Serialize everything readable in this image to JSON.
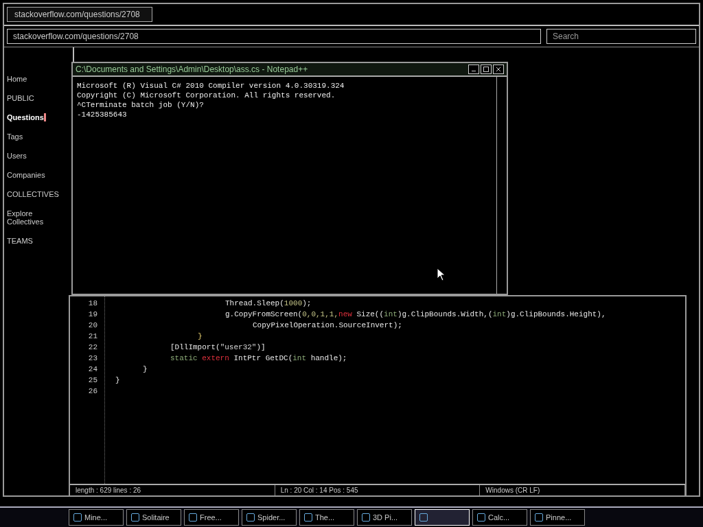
{
  "browser": {
    "tab_title": "stackoverflow.com/questions/2708",
    "address": "stackoverflow.com/questions/2708",
    "search_placeholder": "Search"
  },
  "sidebar": {
    "items": [
      {
        "label": "Home",
        "selected": false
      },
      {
        "label": "PUBLIC",
        "selected": false
      },
      {
        "label": "Questions",
        "selected": true
      },
      {
        "label": "Tags",
        "selected": false
      },
      {
        "label": "Users",
        "selected": false
      },
      {
        "label": "Companies",
        "selected": false
      },
      {
        "label": "COLLECTIVES",
        "selected": false
      },
      {
        "label": "Explore Collectives",
        "selected": false
      },
      {
        "label": "TEAMS",
        "selected": false
      }
    ]
  },
  "console": {
    "title": "C:\\Documents and Settings\\Admin\\Desktop\\ass.cs - Notepad++",
    "lines": [
      "Microsoft (R) Visual C# 2010 Compiler version 4.0.30319.324",
      "Copyright (C) Microsoft Corporation. All rights reserved.",
      "^CTerminate batch job (Y/N)?",
      "-1425385643"
    ]
  },
  "editor": {
    "lines": [
      {
        "children": [
          {
            "children": [
              {
                "children": [
                  {
                    "children": [
                      {
                        "number": "18",
                        "tokens": [
                          {
                            "kind": "plain",
                            "text": "Thread.Sleep("
                          },
                          {
                            "kind": "number",
                            "text": "1000"
                          },
                          {
                            "kind": "plain",
                            "text": ");"
                          }
                        ]
                      },
                      {
                        "number": "19",
                        "tokens": [
                          {
                            "kind": "plain",
                            "text": "g.CopyFromScreen("
                          },
                          {
                            "kind": "number",
                            "text": "0,0,1,1,"
                          },
                          {
                            "kind": "keyword",
                            "text": "new"
                          },
                          {
                            "kind": "plain",
                            "text": " Size(("
                          },
                          {
                            "kind": "type",
                            "text": "int"
                          },
                          {
                            "kind": "plain",
                            "text": ")g.ClipBounds.Width,("
                          },
                          {
                            "kind": "type",
                            "text": "int"
                          },
                          {
                            "kind": "plain",
                            "text": ")g.ClipBounds.Height),"
                          }
                        ]
                      },
                      {
                        "children": [
                          {
                            "number": "20",
                            "tokens": [
                              {
                                "kind": "plain",
                                "text": "CopyPixelOperation.SourceInvert);"
                              }
                            ]
                          }
                        ]
                      }
                    ]
                  },
                  {
                    "number": "21",
                    "tokens": [
                      {
                        "kind": "brace",
                        "text": "}"
                      }
                    ]
                  }
                ]
              },
              {
                "number": "22",
                "tokens": [
                  {
                    "kind": "plain",
                    "text": "[DllImport("
                  },
                  {
                    "kind": "string",
                    "text": "\"user32\""
                  },
                  {
                    "kind": "plain",
                    "text": ")]"
                  }
                ]
              },
              {
                "number": "23",
                "tokens": [
                  {
                    "kind": "type",
                    "text": "static "
                  },
                  {
                    "kind": "keyword",
                    "text": "extern"
                  },
                  {
                    "kind": "plain",
                    "text": " IntPtr GetDC("
                  },
                  {
                    "kind": "type",
                    "text": "int"
                  },
                  {
                    "kind": "plain",
                    "text": " handle);"
                  }
                ]
              }
            ]
          },
          {
            "number": "24",
            "tokens": [
              {
                "kind": "plain",
                "text": "}"
              }
            ]
          }
        ]
      },
      {
        "number": "25",
        "tokens": [
          {
            "kind": "plain",
            "text": "}"
          }
        ]
      },
      {
        "number": "26"
      }
    ],
    "status": [
      "length : 629    lines : 26",
      "Ln : 20    Col : 14    Pos : 545",
      "Windows (CR LF)"
    ]
  },
  "taskbar": {
    "items": [
      {
        "label": "Mine...",
        "selected": false
      },
      {
        "label": "Solitaire",
        "selected": false
      },
      {
        "label": "Free...",
        "selected": false
      },
      {
        "label": "Spider...",
        "selected": false
      },
      {
        "label": "The...",
        "selected": false
      },
      {
        "label": "3D Pi...",
        "selected": false
      },
      {
        "selected": true
      },
      {
        "label": "Calc...",
        "selected": false
      },
      {
        "label": "Pinne...",
        "selected": false
      }
    ]
  }
}
